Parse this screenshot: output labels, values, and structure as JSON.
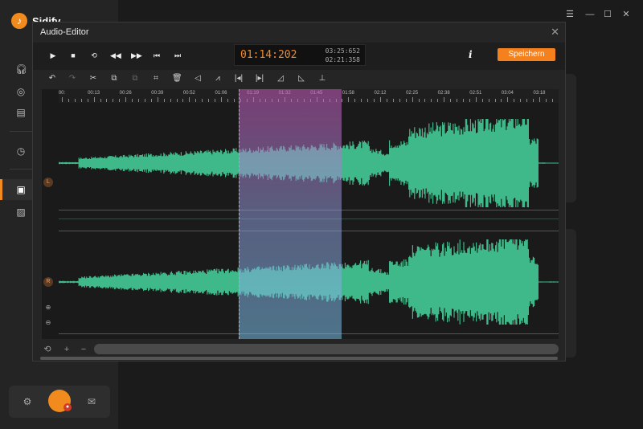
{
  "app": {
    "name": "Sidify",
    "logo": "music-note-logo"
  },
  "dialog": {
    "title": "Audio-Editor",
    "close": "✕"
  },
  "transport": {
    "current_time": "01:14:202",
    "total_time": "03:25:652",
    "selection_time": "02:21:358",
    "save_label": "Speichern",
    "info_label": "i"
  },
  "ruler": [
    "00:",
    "00:13",
    "00:26",
    "00:39",
    "00:52",
    "01:06",
    "01:19",
    "01:32",
    "01:45",
    "01:58",
    "02:12",
    "02:25",
    "02:38",
    "02:51",
    "03:04",
    "03:18"
  ],
  "channels": {
    "left": "L",
    "right": "R"
  },
  "selection": {
    "start_fraction": 0.3,
    "end_fraction": 0.5
  },
  "colors": {
    "accent": "#f5801e",
    "waveform": "#3fb98a"
  }
}
